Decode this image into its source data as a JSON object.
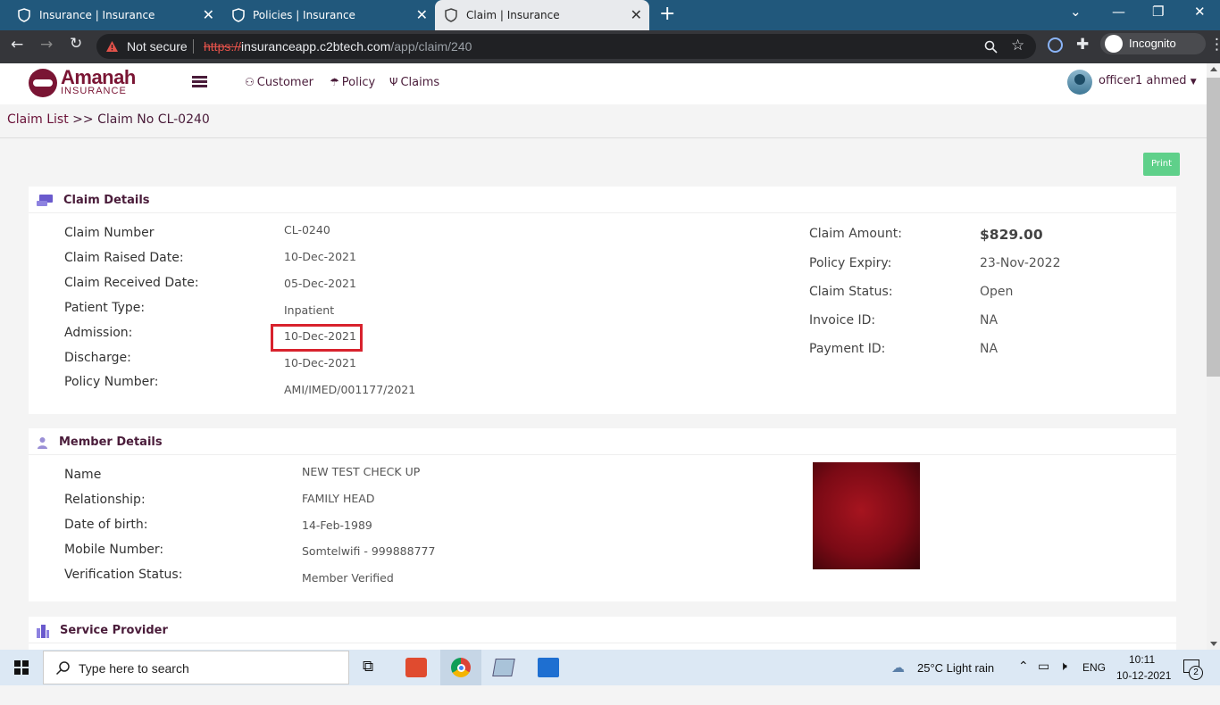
{
  "browser": {
    "tabs": [
      {
        "title": "Insurance | Insurance",
        "active": false
      },
      {
        "title": "Policies | Insurance",
        "active": false
      },
      {
        "title": "Claim | Insurance",
        "active": true
      }
    ],
    "security": "Not secure",
    "url_scheme": "https://",
    "url_host": "insuranceapp.c2btech.com",
    "url_path": "/app/claim/240",
    "incognito_label": "Incognito"
  },
  "app": {
    "logo_name": "Amanah",
    "logo_sub": "INSURANCE",
    "nav": [
      {
        "label": "Customer",
        "icon": "user-icon"
      },
      {
        "label": "Policy",
        "icon": "umbrella-icon"
      },
      {
        "label": "Claims",
        "icon": "claims-icon"
      }
    ],
    "user_name": "officer1 ahmed"
  },
  "breadcrumb": {
    "link": "Claim List",
    "separator": ">>",
    "current": "Claim No CL-0240"
  },
  "print_label": "Print",
  "claim_details": {
    "title": "Claim Details",
    "left": [
      {
        "label": "Claim Number",
        "value": "CL-0240"
      },
      {
        "label": "Claim Raised Date:",
        "value": "10-Dec-2021"
      },
      {
        "label": "Claim Received Date:",
        "value": "05-Dec-2021"
      },
      {
        "label": "Patient Type:",
        "value": "Inpatient"
      },
      {
        "label": "Admission:",
        "value": "10-Dec-2021"
      },
      {
        "label": "Discharge:",
        "value": "10-Dec-2021"
      },
      {
        "label": "Policy Number:",
        "value": "AMI/IMED/001177/2021"
      }
    ],
    "right": [
      {
        "label": "Claim Amount:",
        "value": "$829.00"
      },
      {
        "label": "Policy Expiry:",
        "value": "23-Nov-2022"
      },
      {
        "label": "Claim Status:",
        "value": "Open"
      },
      {
        "label": "Invoice ID:",
        "value": "NA"
      },
      {
        "label": "Payment ID:",
        "value": "NA"
      }
    ]
  },
  "member_details": {
    "title": "Member Details",
    "rows": [
      {
        "label": "Name",
        "value": "NEW TEST CHECK UP"
      },
      {
        "label": "Relationship:",
        "value": "FAMILY HEAD"
      },
      {
        "label": "Date of birth:",
        "value": "14-Feb-1989"
      },
      {
        "label": "Mobile Number:",
        "value": "Somtelwifi - 999888777"
      },
      {
        "label": "Verification Status:",
        "value": "Member Verified"
      }
    ]
  },
  "service_provider": {
    "title": "Service Provider"
  },
  "taskbar": {
    "search_placeholder": "Type here to search",
    "weather": "25°C  Light rain",
    "language": "ENG",
    "time": "10:11",
    "date": "10-12-2021",
    "notifications": "2"
  },
  "colors": {
    "accent": "#4a1c3a",
    "brand": "#7a1534",
    "print": "#5fd08a",
    "highlight": "#d8222d"
  }
}
